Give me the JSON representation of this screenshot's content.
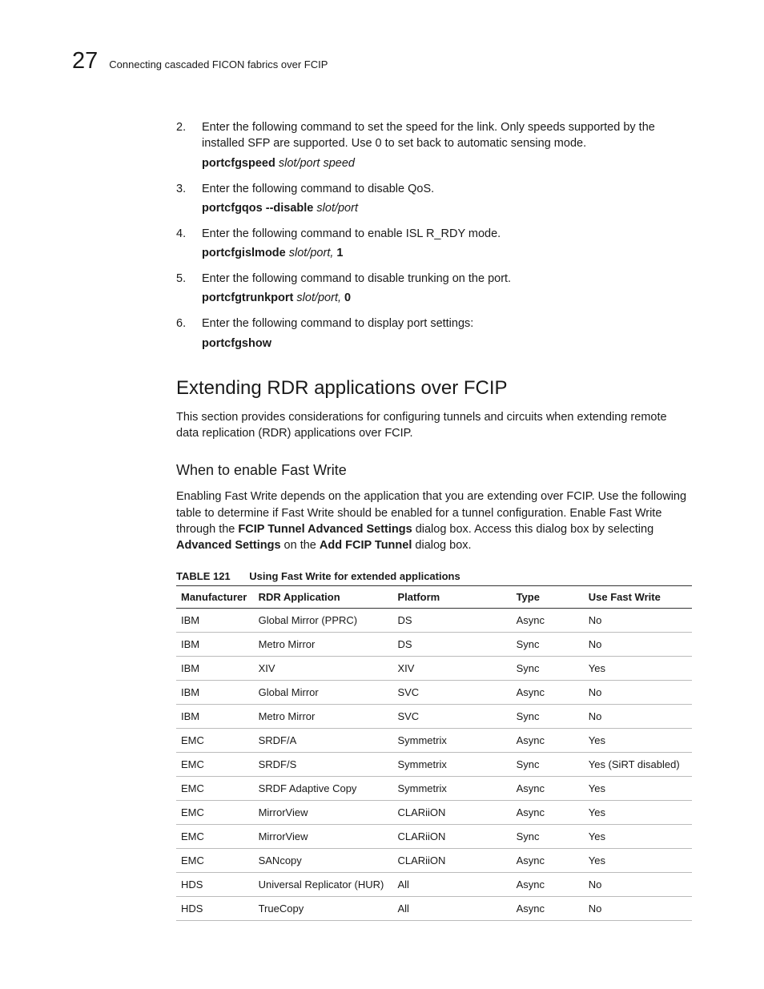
{
  "header": {
    "chapter_number": "27",
    "chapter_title": "Connecting cascaded FICON fabrics over FCIP"
  },
  "steps": [
    {
      "num": "2.",
      "text": "Enter the following command to set the speed for the link. Only speeds supported by the installed SFP are supported. Use 0 to set back to automatic sensing mode.",
      "cmd_bold": "portcfgspeed",
      "cmd_ital": " slot/port speed",
      "cmd_suffix": ""
    },
    {
      "num": "3.",
      "text": "Enter the following command to disable QoS.",
      "cmd_bold": "portcfgqos --disable",
      "cmd_ital": " slot/port",
      "cmd_suffix": ""
    },
    {
      "num": "4.",
      "text": "Enter the following command to enable ISL R_RDY mode.",
      "cmd_bold": "portcfgislmode",
      "cmd_ital": " slot/port,",
      "cmd_suffix": " 1"
    },
    {
      "num": "5.",
      "text": "Enter the following command to disable trunking on the port.",
      "cmd_bold": "portcfgtrunkport",
      "cmd_ital": " slot/port,",
      "cmd_suffix": " 0"
    },
    {
      "num": "6.",
      "text": "Enter the following command to display port settings:",
      "cmd_bold": "portcfgshow",
      "cmd_ital": "",
      "cmd_suffix": ""
    }
  ],
  "section": {
    "heading": "Extending RDR applications over FCIP",
    "intro": "This section provides considerations for configuring tunnels and circuits when extending remote data replication (RDR) applications over FCIP."
  },
  "subsection": {
    "heading": "When to enable Fast Write",
    "para_pre": "Enabling Fast Write depends on the application that you are extending over FCIP. Use the following table to determine if Fast Write should be enabled for a tunnel configuration. Enable Fast Write through the ",
    "b1": "FCIP Tunnel Advanced Settings",
    "mid1": " dialog box. Access this dialog box by selecting ",
    "b2": "Advanced Settings",
    "mid2": " on the ",
    "b3": "Add FCIP Tunnel",
    "post": " dialog box."
  },
  "table": {
    "label": "TABLE 121",
    "title": "Using Fast Write for extended applications",
    "headers": [
      "Manufacturer",
      "RDR Application",
      "Platform",
      "Type",
      "Use Fast Write"
    ],
    "rows": [
      [
        "IBM",
        "Global Mirror (PPRC)",
        "DS",
        "Async",
        "No"
      ],
      [
        "IBM",
        "Metro Mirror",
        "DS",
        "Sync",
        "No"
      ],
      [
        "IBM",
        "XIV",
        "XIV",
        "Sync",
        "Yes"
      ],
      [
        "IBM",
        "Global Mirror",
        "SVC",
        "Async",
        "No"
      ],
      [
        "IBM",
        "Metro Mirror",
        "SVC",
        "Sync",
        "No"
      ],
      [
        "EMC",
        "SRDF/A",
        "Symmetrix",
        "Async",
        "Yes"
      ],
      [
        "EMC",
        "SRDF/S",
        "Symmetrix",
        "Sync",
        "Yes (SiRT disabled)"
      ],
      [
        "EMC",
        "SRDF Adaptive Copy",
        "Symmetrix",
        "Async",
        "Yes"
      ],
      [
        "EMC",
        "MirrorView",
        "CLARiiON",
        "Async",
        "Yes"
      ],
      [
        "EMC",
        "MirrorView",
        "CLARiiON",
        "Sync",
        "Yes"
      ],
      [
        "EMC",
        "SANcopy",
        "CLARiiON",
        "Async",
        "Yes"
      ],
      [
        "HDS",
        "Universal Replicator (HUR)",
        "All",
        "Async",
        "No"
      ],
      [
        "HDS",
        "TrueCopy",
        "All",
        "Async",
        "No"
      ]
    ]
  }
}
